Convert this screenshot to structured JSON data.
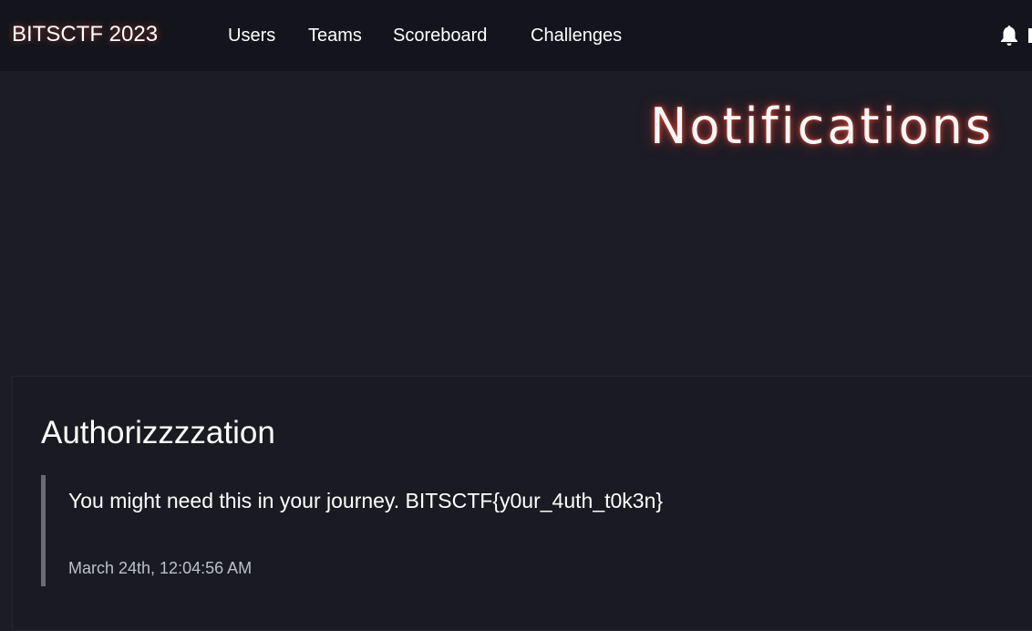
{
  "navbar": {
    "brand": "BITSCTF 2023",
    "links": [
      {
        "label": "Users"
      },
      {
        "label": "Teams"
      },
      {
        "label": "Scoreboard"
      },
      {
        "label": "Challenges"
      }
    ],
    "notification_icon": "bell-icon"
  },
  "page": {
    "title": "Notifications"
  },
  "notifications": [
    {
      "title": "Authorizzzzation",
      "body": "You might need this in your journey. BITSCTF{y0ur_4uth_t0k3n}",
      "date": "March 24th, 12:04:56 AM"
    }
  ],
  "colors": {
    "background": "#1c1c25",
    "navbar": "#14151c",
    "glow": "#ff5040",
    "quote_bar": "#6a6c74"
  }
}
